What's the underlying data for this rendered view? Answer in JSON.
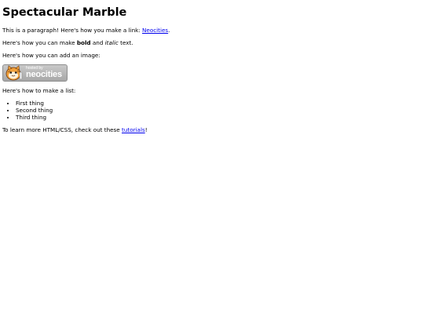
{
  "page": {
    "title": "Spectacular Marble",
    "intro_text": "This is a paragraph! Here's how you make a link: ",
    "intro_link": "Neocities",
    "intro_end": ".",
    "bold_pre": "Here's how you can make ",
    "bold_word": "bold",
    "bold_mid": " and ",
    "italic_word": "italic",
    "bold_end": " text.",
    "image_text": "Here's how you can add an image:",
    "badge_small": "hosted by",
    "badge_big": "neocities",
    "list_text": "Here's how to make a list:",
    "list_items": [
      "First thing",
      "Second thing",
      "Third thing"
    ],
    "learn_pre": "To learn more HTML/CSS, check out these ",
    "learn_link": "tutorials",
    "learn_end": "!"
  }
}
